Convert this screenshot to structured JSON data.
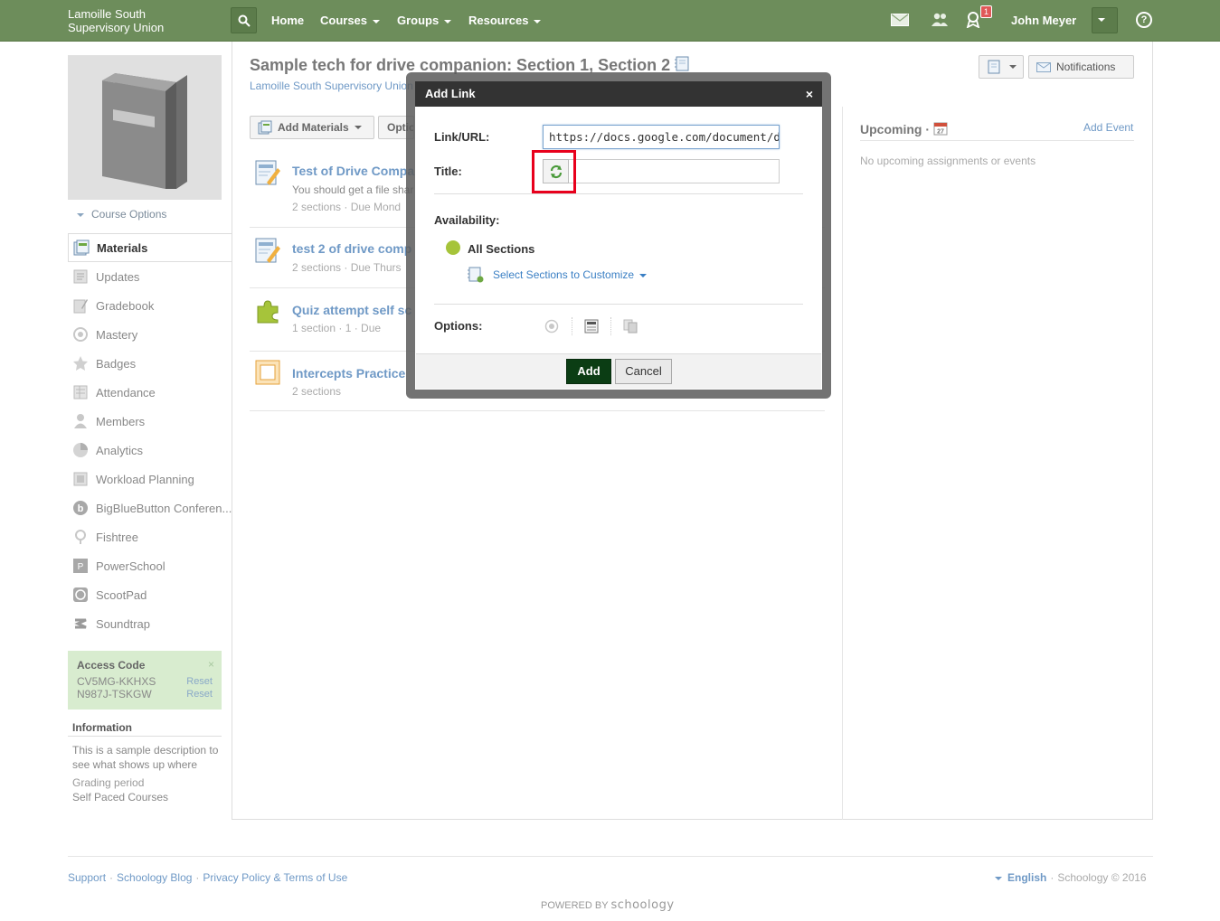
{
  "header": {
    "brand_line1": "Lamoille South",
    "brand_line2": "Supervisory Union",
    "nav": [
      "Home",
      "Courses",
      "Groups",
      "Resources"
    ],
    "notification_count": "1",
    "user_name": "John Meyer",
    "help_label": "?"
  },
  "sidebar": {
    "course_options": "Course Options",
    "items": [
      {
        "label": "Materials",
        "icon": "materials-icon"
      },
      {
        "label": "Updates",
        "icon": "updates-icon"
      },
      {
        "label": "Gradebook",
        "icon": "gradebook-icon"
      },
      {
        "label": "Mastery",
        "icon": "mastery-icon"
      },
      {
        "label": "Badges",
        "icon": "badges-icon"
      },
      {
        "label": "Attendance",
        "icon": "attendance-icon"
      },
      {
        "label": "Members",
        "icon": "members-icon"
      },
      {
        "label": "Analytics",
        "icon": "analytics-icon"
      },
      {
        "label": "Workload Planning",
        "icon": "workload-icon"
      },
      {
        "label": "BigBlueButton Conferen...",
        "icon": "bigbluebutton-icon"
      },
      {
        "label": "Fishtree",
        "icon": "fishtree-icon"
      },
      {
        "label": "PowerSchool",
        "icon": "powerschool-icon"
      },
      {
        "label": "ScootPad",
        "icon": "scootpad-icon"
      },
      {
        "label": "Soundtrap",
        "icon": "soundtrap-icon"
      }
    ],
    "access_code": {
      "title": "Access Code",
      "codes": [
        "CV5MG-KKHXS",
        "N987J-TSKGW"
      ],
      "reset_label": "Reset",
      "close": "×"
    },
    "information": {
      "title": "Information",
      "description": "This is a sample description to see what shows up where",
      "grading_label": "Grading period",
      "grading_value": "Self Paced Courses"
    }
  },
  "main": {
    "title": "Sample tech for drive companion: Section 1, Section 2",
    "subtitle": "Lamoille South Supervisory Union",
    "add_materials": "Add Materials",
    "options_label": "Optio",
    "notifications": "Notifications",
    "materials": [
      {
        "title": "Test of Drive Compa",
        "subtitle": "You should get a file shar",
        "meta": "2 sections · Due Mond"
      },
      {
        "title": "test 2 of drive comp",
        "subtitle": "",
        "meta": "2 sections · Due Thurs"
      },
      {
        "title": "Quiz attempt self sc",
        "subtitle": "",
        "meta": "1 section · 1 · Due"
      },
      {
        "title": "Intercepts Practice",
        "subtitle": "",
        "meta": "2 sections"
      }
    ]
  },
  "upcoming": {
    "title": "Upcoming ·",
    "calendar_day": "27",
    "add_event": "Add Event",
    "empty": "No upcoming assignments or events"
  },
  "modal": {
    "title": "Add Link",
    "close": "×",
    "link_label": "Link/URL:",
    "link_value": "https://docs.google.com/document/d/",
    "title_label": "Title:",
    "title_value": "",
    "availability_label": "Availability:",
    "all_sections": "All Sections",
    "select_sections": "Select Sections to Customize",
    "options_label": "Options:",
    "add_button": "Add",
    "cancel_button": "Cancel"
  },
  "footer": {
    "links": [
      "Support",
      "Schoology Blog",
      "Privacy Policy & Terms of Use"
    ],
    "language": "English",
    "copyright": "Schoology © 2016",
    "powered_by": "POWERED BY",
    "logo": "schoology"
  },
  "colors": {
    "header_green": "#6d8d5b",
    "link_blue": "#6f99c6",
    "add_button": "#0b3d14",
    "highlight_red": "#e8001c",
    "availability_dot": "#a6c43a"
  }
}
